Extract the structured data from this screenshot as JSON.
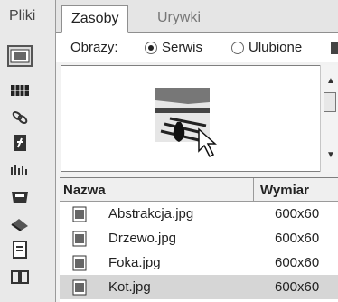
{
  "left_panel": {
    "tab_label": "Pliki",
    "icons": [
      {
        "name": "screen-icon",
        "selected": true
      },
      {
        "name": "grid-icon",
        "selected": false
      },
      {
        "name": "link-icon",
        "selected": false
      },
      {
        "name": "file-flash-icon",
        "selected": false
      },
      {
        "name": "ruler-icon",
        "selected": false
      },
      {
        "name": "bin-icon",
        "selected": false
      },
      {
        "name": "eraser-icon",
        "selected": false
      },
      {
        "name": "document-icon",
        "selected": false
      },
      {
        "name": "book-icon",
        "selected": false
      }
    ]
  },
  "tabs": {
    "active": "Zasoby",
    "inactive": "Urywki"
  },
  "images_filter": {
    "label": "Obrazy:",
    "options": [
      {
        "label": "Serwis",
        "checked": true
      },
      {
        "label": "Ulubione",
        "checked": false
      }
    ]
  },
  "table": {
    "columns": [
      "Nazwa",
      "Wymiar"
    ],
    "rows": [
      {
        "name": "Abstrakcja.jpg",
        "size": "600x60",
        "selected": false
      },
      {
        "name": "Drzewo.jpg",
        "size": "600x60",
        "selected": false
      },
      {
        "name": "Foka.jpg",
        "size": "600x60",
        "selected": false
      },
      {
        "name": "Kot.jpg",
        "size": "600x60",
        "selected": true
      }
    ]
  }
}
